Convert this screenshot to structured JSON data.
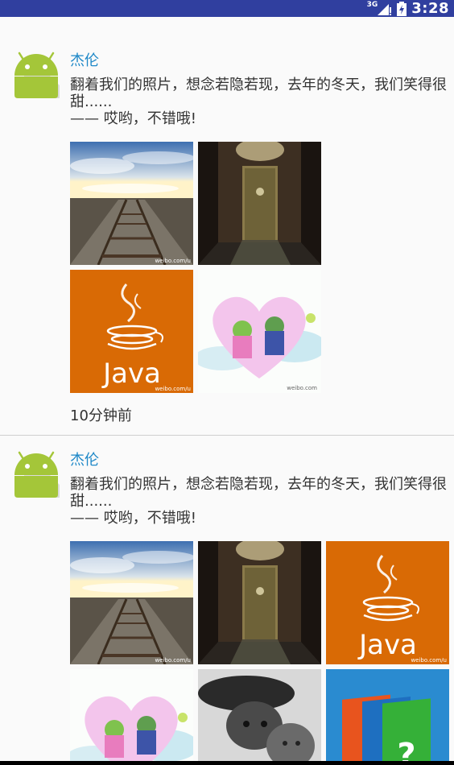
{
  "status_bar": {
    "network": "3G",
    "time": "3:28",
    "colors": {
      "background": "#303f9f"
    }
  },
  "feed": {
    "posts": [
      {
        "author": "杰伦",
        "text": "翻着我们的照片，想念若隐若现，去年的冬天，我们笑得很甜......\n—— 哎哟，不错哦!",
        "time_ago": "10分钟前",
        "images": [
          "railway-photo",
          "apple-door-photo",
          "java-logo-image",
          "android-couple-drawing"
        ],
        "watermark": "weibo.com/u"
      },
      {
        "author": "杰伦",
        "text": "翻着我们的照片，想念若隐若现，去年的冬天，我们笑得很甜......\n—— 哎哟，不错哦!",
        "images": [
          "railway-photo",
          "apple-door-photo",
          "java-logo-image",
          "android-couple-drawing",
          "cat-photo",
          "folders-icon-image"
        ],
        "watermark": "weibo.com/u"
      }
    ]
  },
  "colors": {
    "author_name": "#1e88c8",
    "java_orange": "#d96a05",
    "android_green": "#a4c639"
  }
}
